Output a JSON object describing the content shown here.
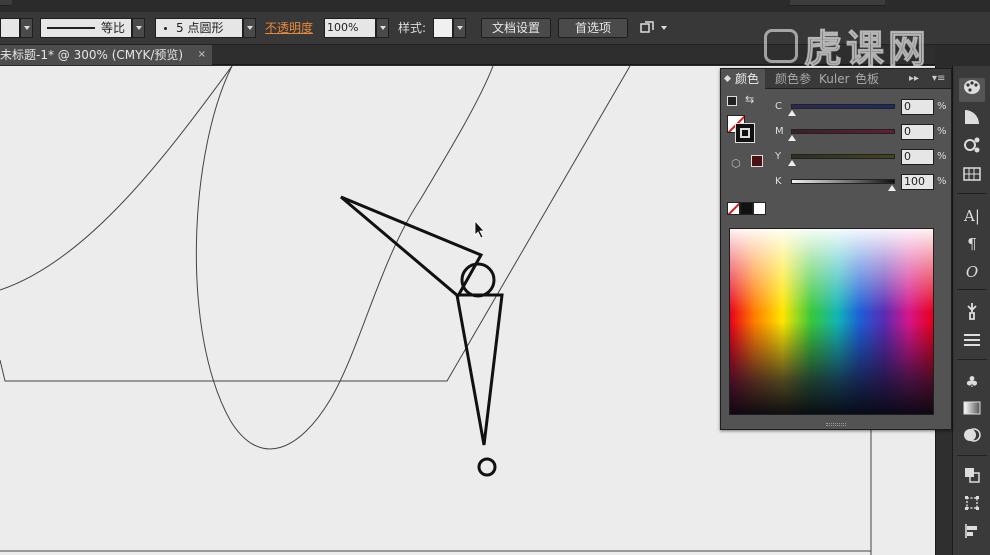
{
  "control_bar": {
    "stroke_profile_label": "等比",
    "brush_label": "5 点圆形",
    "opacity_label": "不透明度",
    "opacity_value": "100%",
    "style_label": "样式:",
    "doc_setup_button": "文档设置",
    "preferences_button": "首选项"
  },
  "tab": {
    "title": "未标题-1* @ 300% (CMYK/预览)",
    "close_symbol": "×"
  },
  "color_panel": {
    "tabs": [
      "颜色",
      "颜色参",
      "Kuler",
      "色板"
    ],
    "sliders": [
      {
        "letter": "C",
        "value": "0",
        "pct": "%",
        "color": "#2a2a55"
      },
      {
        "letter": "M",
        "value": "0",
        "pct": "%",
        "color": "#552a3a"
      },
      {
        "letter": "Y",
        "value": "0",
        "pct": "%",
        "color": "#3f3f28"
      },
      {
        "letter": "K",
        "value": "100",
        "pct": "%",
        "color": "#888888"
      }
    ],
    "slider_levels_percent": [
      0,
      0,
      0,
      100
    ]
  },
  "watermark": {
    "text": "虎课网"
  },
  "accent_colors": {
    "opacity_link": "#e8883a",
    "canvas": "#ececec",
    "panel": "#535353"
  }
}
